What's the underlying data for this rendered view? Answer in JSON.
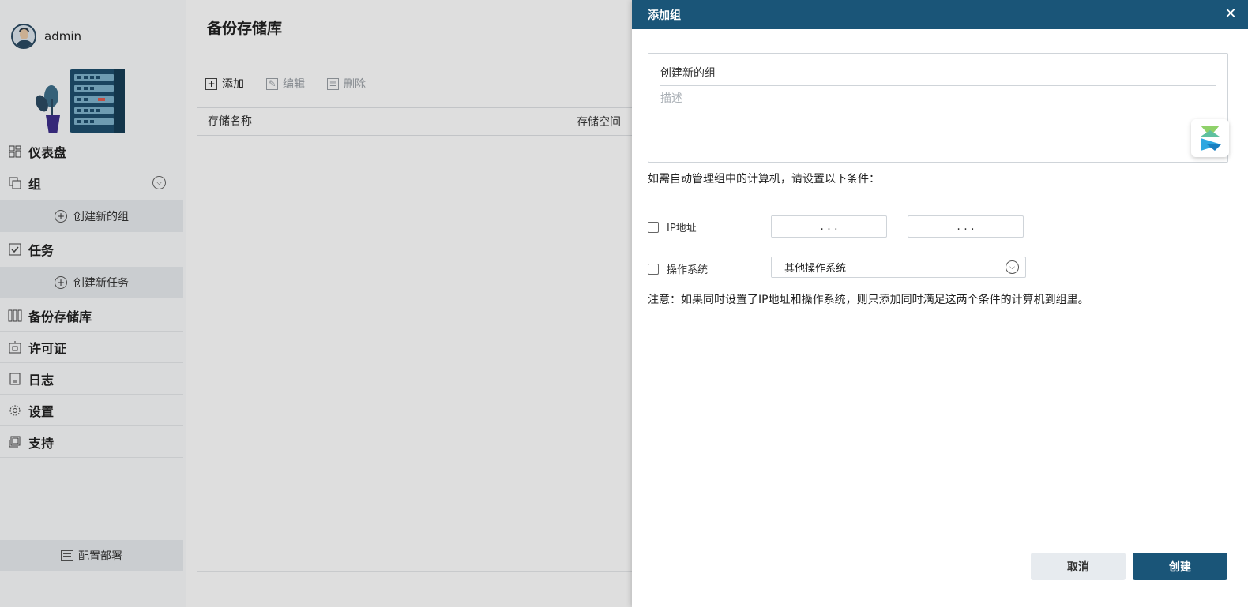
{
  "user": {
    "name": "admin"
  },
  "sidebar": {
    "items": [
      {
        "label": "仪表盘",
        "icon": "dashboard-icon"
      },
      {
        "label": "组",
        "icon": "group-icon",
        "sub_button": "创建新的组"
      },
      {
        "label": "任务",
        "icon": "task-icon",
        "sub_button": "创建新任务"
      },
      {
        "label": "备份存储库",
        "icon": "storage-icon"
      },
      {
        "label": "许可证",
        "icon": "license-icon"
      },
      {
        "label": "日志",
        "icon": "log-icon"
      },
      {
        "label": "设置",
        "icon": "gear-icon"
      },
      {
        "label": "支持",
        "icon": "support-icon"
      }
    ],
    "deploy_label": "配置部署"
  },
  "main": {
    "title": "备份存储库",
    "toolbar": {
      "add": "添加",
      "edit": "编辑",
      "delete": "删除"
    },
    "columns": [
      "存储名称",
      "存储空间"
    ]
  },
  "dialog": {
    "title": "添加组",
    "name_value": "创建新的组",
    "desc_placeholder": "描述",
    "condition_text": "如需自动管理组中的计算机，请设置以下条件：",
    "ip_label": "IP地址",
    "ip_from": ".     .     .",
    "ip_to": ".     .     .",
    "os_label": "操作系统",
    "os_value": "其他操作系统",
    "note": "注意：如果同时设置了IP地址和操作系统，则只添加同时满足这两个条件的计算机到组里。",
    "cancel": "取消",
    "create": "创建"
  },
  "colors": {
    "header": "#1a5578",
    "accent": "#1a5578",
    "secondary_button": "#e7ebef"
  }
}
